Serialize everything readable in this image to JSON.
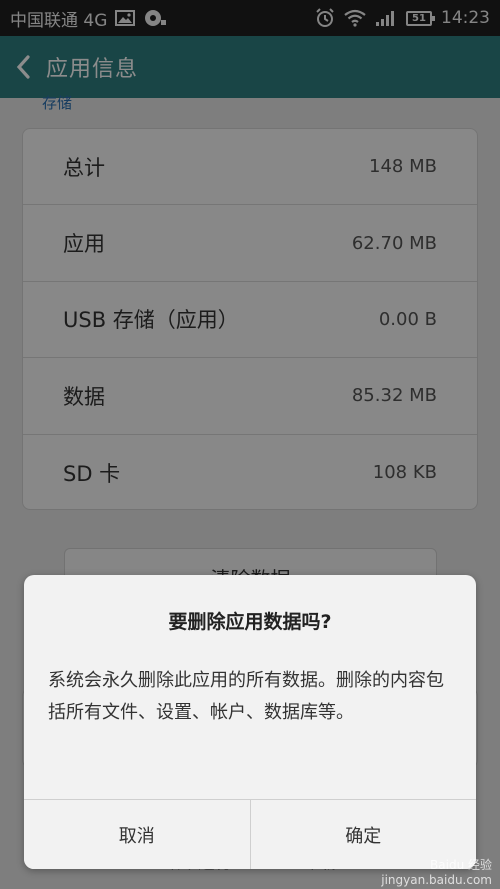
{
  "status_bar": {
    "carrier": "中国联通 4G",
    "time": "14:23",
    "battery": "51",
    "icons": [
      "image-icon",
      "media-icon",
      "alarm-icon",
      "wifi-icon",
      "signal-icon",
      "battery-icon"
    ]
  },
  "action_bar": {
    "title": "应用信息",
    "back_icon": "chevron-left-icon"
  },
  "section": {
    "label": "存储"
  },
  "storage": {
    "rows": [
      {
        "label": "总计",
        "value": "148 MB"
      },
      {
        "label": "应用",
        "value": "62.70 MB"
      },
      {
        "label": "USB 存储（应用）",
        "value": "0.00 B"
      },
      {
        "label": "数据",
        "value": "85.32 MB"
      },
      {
        "label": "SD 卡",
        "value": "108 KB"
      }
    ]
  },
  "clear_button": {
    "label": "清除数据"
  },
  "bottom": {
    "force_stop": "结束运行",
    "uninstall": "卸载"
  },
  "dialog": {
    "title": "要删除应用数据吗?",
    "message": "系统会永久删除此应用的所有数据。删除的内容包括所有文件、设置、帐户、数据库等。",
    "cancel": "取消",
    "confirm": "确定"
  },
  "watermark": {
    "brand": "Baidu 经验",
    "url": "jingyan.baidu.com"
  },
  "colors": {
    "accent": "#2f7f80",
    "status_bar": "#1f1f1f"
  }
}
